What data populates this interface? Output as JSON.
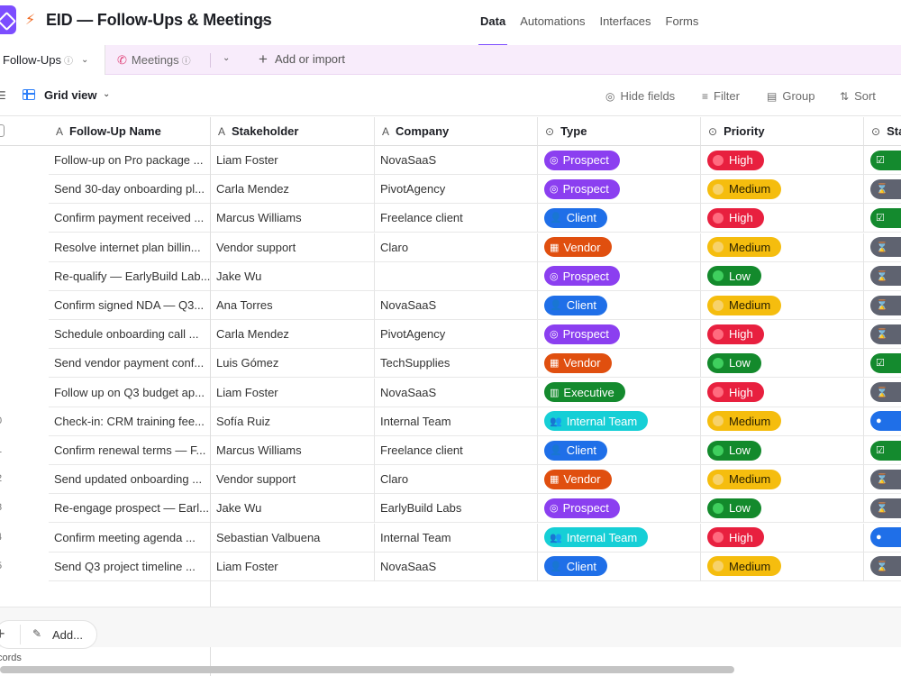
{
  "header": {
    "base_title": "EID — Follow-Ups & Meetings",
    "nav": [
      "Data",
      "Automations",
      "Interfaces",
      "Forms"
    ],
    "active_nav": "Data"
  },
  "tabs": {
    "active": "Follow-Ups",
    "second": "Meetings",
    "add_import": "Add or import"
  },
  "view": {
    "name": "Grid view",
    "tools": {
      "hide_fields": "Hide fields",
      "filter": "Filter",
      "group": "Group",
      "sort": "Sort"
    }
  },
  "columns": {
    "name": "Follow-Up Name",
    "stakeholder": "Stakeholder",
    "company": "Company",
    "type": "Type",
    "priority": "Priority",
    "status": "Sta"
  },
  "type_colors": {
    "Prospect": "#8b3ff0",
    "Client": "#1f6fe8",
    "Vendor": "#e04f0f",
    "Executive": "#148a2e",
    "Internal Team": "#16cfd6"
  },
  "priority_colors": {
    "High": "#e8203f",
    "Medium": "#f5bd0e",
    "Low": "#138a2c"
  },
  "rows": [
    {
      "num": "",
      "name": "Follow-up on Pro package ...",
      "stakeholder": "Liam Foster",
      "company": "NovaSaaS",
      "type": "Prospect",
      "priority": "High",
      "status": "done"
    },
    {
      "num": "",
      "name": "Send 30-day onboarding pl...",
      "stakeholder": "Carla Mendez",
      "company": "PivotAgency",
      "type": "Prospect",
      "priority": "Medium",
      "status": "pending"
    },
    {
      "num": "",
      "name": "Confirm payment received ...",
      "stakeholder": "Marcus Williams",
      "company": "Freelance client",
      "type": "Client",
      "priority": "High",
      "status": "done"
    },
    {
      "num": "",
      "name": "Resolve internet plan billin...",
      "stakeholder": "Vendor support",
      "company": "Claro",
      "type": "Vendor",
      "priority": "Medium",
      "status": "pending"
    },
    {
      "num": "",
      "name": "Re-qualify — EarlyBuild Lab...",
      "stakeholder": "Jake Wu",
      "company": "",
      "type": "Prospect",
      "priority": "Low",
      "status": "pending"
    },
    {
      "num": "",
      "name": "Confirm signed NDA — Q3...",
      "stakeholder": "Ana Torres",
      "company": "NovaSaaS",
      "type": "Client",
      "priority": "Medium",
      "status": "pending"
    },
    {
      "num": "",
      "name": "Schedule onboarding call ...",
      "stakeholder": "Carla Mendez",
      "company": "PivotAgency",
      "type": "Prospect",
      "priority": "High",
      "status": "pending"
    },
    {
      "num": "",
      "name": "Send vendor payment conf...",
      "stakeholder": "Luis Gómez",
      "company": "TechSupplies",
      "type": "Vendor",
      "priority": "Low",
      "status": "done"
    },
    {
      "num": "",
      "name": "Follow up on Q3 budget ap...",
      "stakeholder": "Liam Foster",
      "company": "NovaSaaS",
      "type": "Executive",
      "priority": "High",
      "status": "pending"
    },
    {
      "num": "0",
      "name": "Check-in: CRM training fee...",
      "stakeholder": "Sofía Ruiz",
      "company": "Internal Team",
      "type": "Internal Team",
      "priority": "Medium",
      "status": "scheduled"
    },
    {
      "num": "1",
      "name": "Confirm renewal terms — F...",
      "stakeholder": "Marcus Williams",
      "company": "Freelance client",
      "type": "Client",
      "priority": "Low",
      "status": "done"
    },
    {
      "num": "2",
      "name": "Send updated onboarding ...",
      "stakeholder": "Vendor support",
      "company": "Claro",
      "type": "Vendor",
      "priority": "Medium",
      "status": "pending"
    },
    {
      "num": "3",
      "name": "Re-engage prospect — Earl...",
      "stakeholder": "Jake Wu",
      "company": "EarlyBuild Labs",
      "type": "Prospect",
      "priority": "Low",
      "status": "pending"
    },
    {
      "num": "4",
      "name": "Confirm meeting agenda ...",
      "stakeholder": "Sebastian Valbuena",
      "company": "Internal Team",
      "type": "Internal Team",
      "priority": "High",
      "status": "scheduled"
    },
    {
      "num": "5",
      "name": "Send Q3 project timeline ...",
      "stakeholder": "Liam Foster",
      "company": "NovaSaaS",
      "type": "Client",
      "priority": "Medium",
      "status": "pending"
    }
  ],
  "status_colors": {
    "done": "#148a2e",
    "pending": "#5f6370",
    "scheduled": "#1f6fe8"
  },
  "footer": {
    "add_label": "Add...",
    "records_label": "cords"
  }
}
